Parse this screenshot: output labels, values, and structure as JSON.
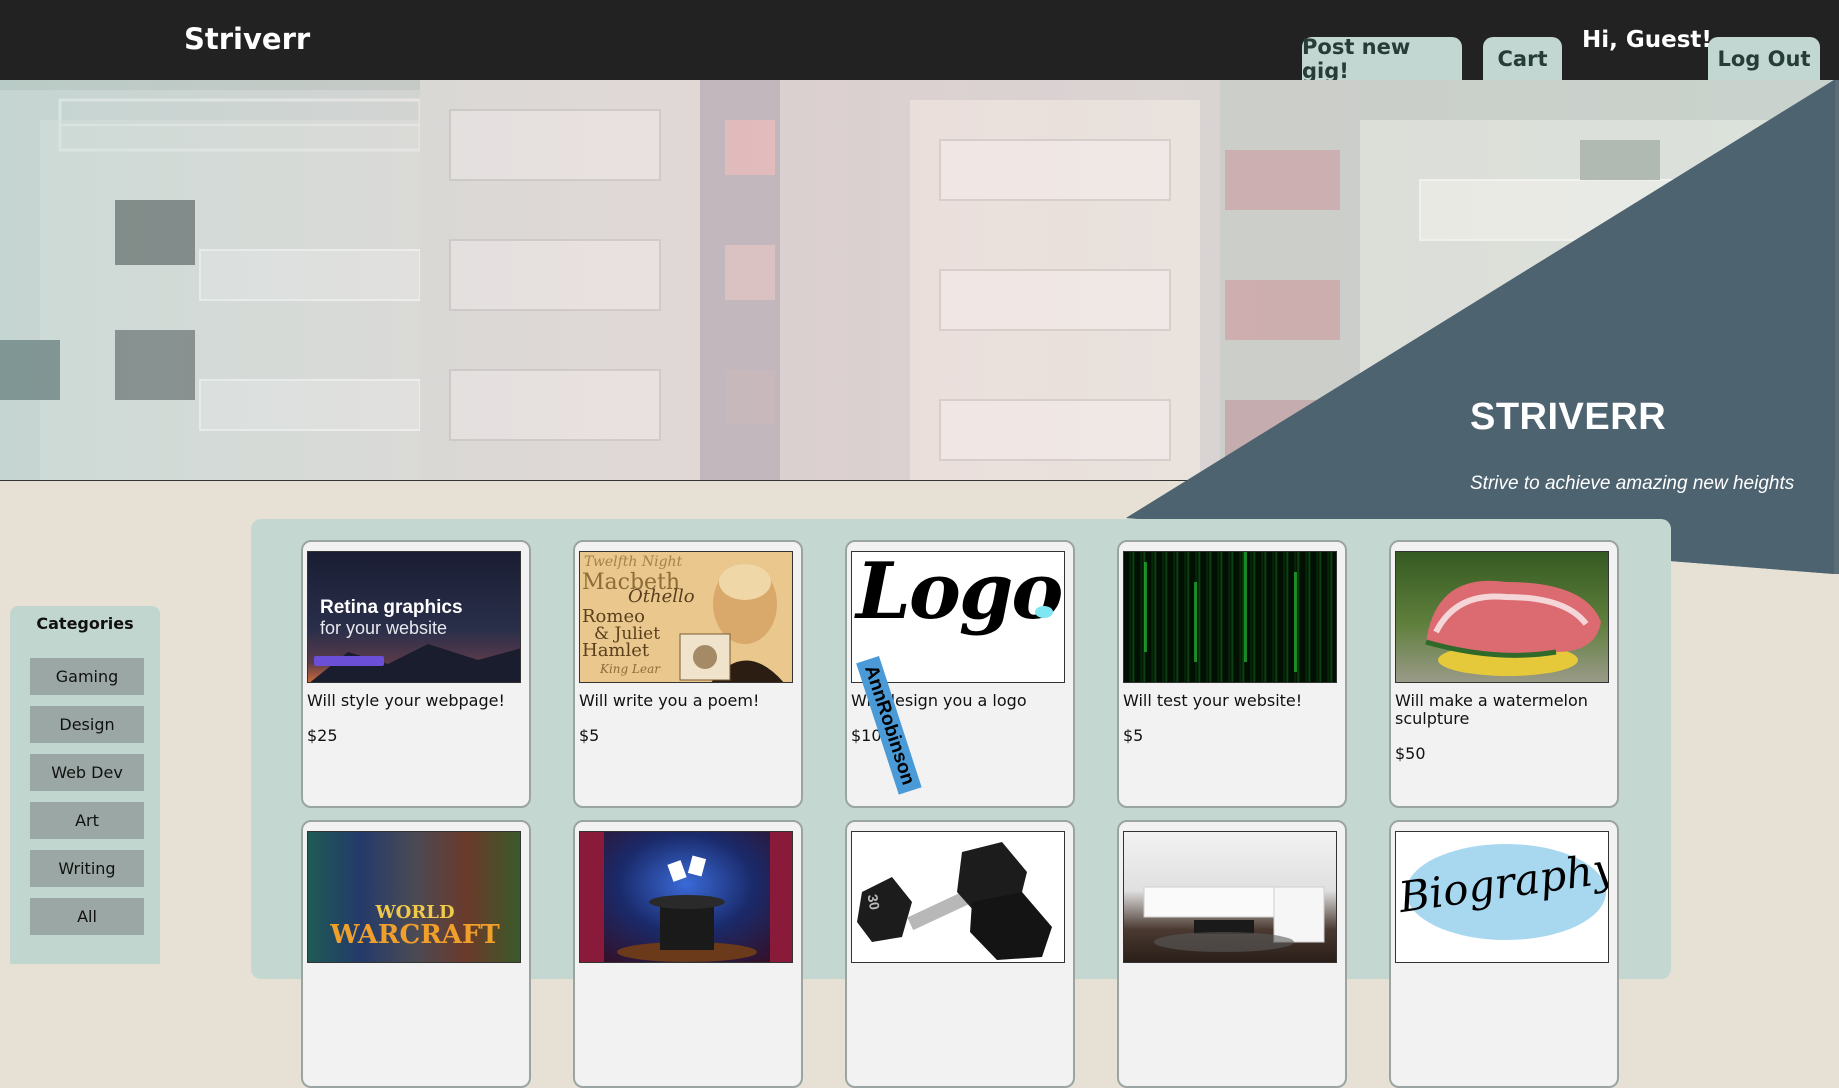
{
  "app": {
    "brand": "Striverr",
    "nav": {
      "post_gig": "Post new gig!",
      "cart": "Cart",
      "greeting": "Hi, Guest!",
      "logout": "Log Out"
    }
  },
  "hero": {
    "title": "STRIVERR",
    "tagline": "Strive to achieve amazing new heights"
  },
  "sidebar": {
    "title": "Categories",
    "items": [
      "Gaming",
      "Design",
      "Web Dev",
      "Art",
      "Writing",
      "All"
    ]
  },
  "gigs": [
    {
      "title": "Will style your webpage!",
      "price": "$25"
    },
    {
      "title": "Will write you a poem!",
      "price": "$5"
    },
    {
      "title": "Will design you a logo",
      "price": "$10"
    },
    {
      "title": "Will test your website!",
      "price": "$5"
    },
    {
      "title": "Will make a watermelon sculpture",
      "price": "$50"
    }
  ],
  "thumbnails": {
    "retina_heading": "Retina graphics",
    "retina_sub": "for your website",
    "poem_words": [
      "Twelfth Night",
      "Macbeth",
      "Othello",
      "Romeo",
      "& Juliet",
      "Hamlet",
      "King Lear"
    ],
    "logo_word": "Logo",
    "logo_watermark": "AnnRobinson",
    "game_title_1": "WORLD",
    "game_title_2": "WARCRAFT",
    "dumbbell_weight": "30",
    "biography_word": "Biography"
  },
  "colors": {
    "topbar": "#222222",
    "nav_button": "#c2d6d2",
    "page_background": "#e6e1d4",
    "panel": "#c5d7d1",
    "hero_triangle": "#4f6470"
  }
}
